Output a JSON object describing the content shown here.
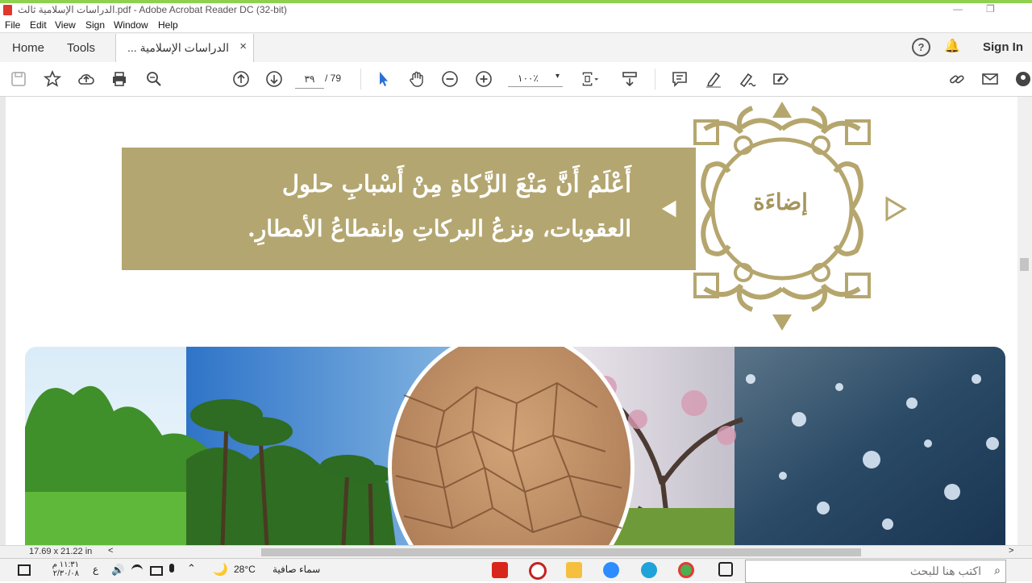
{
  "window": {
    "title": "الدراسات الإسلامية ثالث.pdf - Adobe Acrobat Reader DC (32-bit)",
    "min_glyph": "—",
    "max_glyph": "❐"
  },
  "menu": [
    "File",
    "Edit",
    "View",
    "Sign",
    "Window",
    "Help"
  ],
  "nav": {
    "home": "Home",
    "tools": "Tools",
    "doc_tab": "الدراسات الإسلامية ...",
    "close_glyph": "×",
    "help_glyph": "?",
    "bell_glyph": "🔔",
    "sign_in": "Sign In"
  },
  "toolbar": {
    "page_current": "٣٩",
    "page_total": "/ 79",
    "zoom": "١٠٠٪",
    "zoom_caret": "▾"
  },
  "document": {
    "banner_line1": "أَعْلَمُ أَنَّ مَنْعَ الزَّكاةِ مِنْ أَسْبابِ حلول",
    "banner_line2": "العقوبات، ونزعُ البركاتِ وانقطاعُ الأمطارِ.",
    "badge_label": "إضاءَة"
  },
  "status": {
    "page_size": "17.69 x 21.22 in",
    "scroll_left": "<",
    "scroll_right": ">"
  },
  "taskbar": {
    "search_placeholder": "اكتب هنا للبحث",
    "weather_temp": "28°C",
    "weather_text": "سماء صافية",
    "lang": "ع",
    "time": "١١:٣١ م",
    "date": "٢/٣٠/٠٨"
  },
  "colors": {
    "accent": "#8fd14f",
    "banner": "#b3a670",
    "badge": "#b5a66e",
    "acrobat_red": "#e0382c"
  }
}
